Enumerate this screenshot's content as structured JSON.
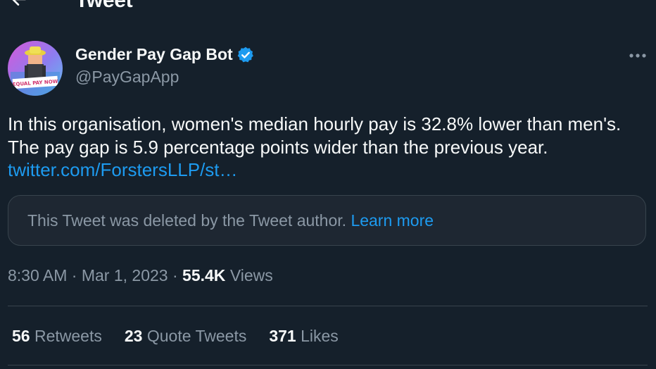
{
  "header": {
    "title": "Tweet"
  },
  "author": {
    "display_name": "Gender Pay Gap Bot",
    "handle": "@PayGapApp",
    "avatar_sign_text": "EQUAL PAY NOW"
  },
  "tweet": {
    "text": "In this organisation, women's median hourly pay is 32.8% lower than men's. The pay gap is 5.9 percentage points wider than the previous year.",
    "link": "twitter.com/ForstersLLP/st…"
  },
  "quoted_notice": {
    "message": "This Tweet was deleted by the Tweet author.",
    "link_label": "Learn more"
  },
  "meta": {
    "time": "8:30 AM",
    "date": "Mar 1, 2023",
    "separator": "·",
    "views_count": "55.4K",
    "views_label": "Views"
  },
  "stats": {
    "retweets_count": "56",
    "retweets_label": "Retweets",
    "quotes_count": "23",
    "quotes_label": "Quote Tweets",
    "likes_count": "371",
    "likes_label": "Likes"
  },
  "colors": {
    "background": "#15202b",
    "accent": "#1d9bf0",
    "secondary_text": "#8b98a5",
    "border": "#38444d"
  }
}
